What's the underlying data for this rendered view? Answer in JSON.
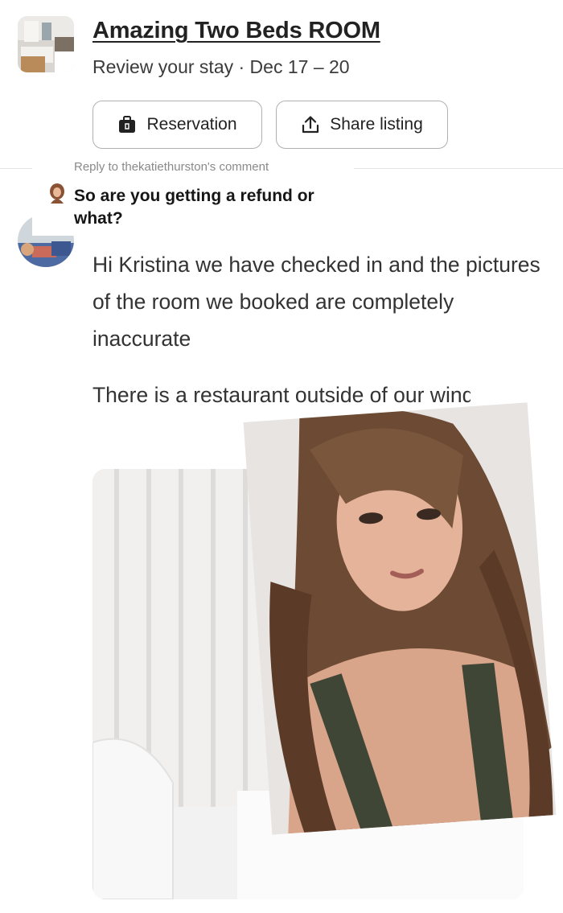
{
  "listing": {
    "title": "Amazing Two Beds ROOM",
    "subtitle": "Review your stay · Dec 17 – 20",
    "thumbnail_icon": "room-thumbnail"
  },
  "actions": {
    "reservation_label": "Reservation",
    "reservation_icon": "briefcase-icon",
    "share_label": "Share listing",
    "share_icon": "share-icon"
  },
  "reply": {
    "meta": "Reply to thekatiethurston's comment",
    "text": "So are you getting a refund or what?"
  },
  "message": {
    "paragraph_1": "Hi Kristina we have checked in and the pictures of the room we booked are completely inaccurate",
    "paragraph_2_visible": "There is a restaurant outside of our window not a view of ou"
  },
  "colors": {
    "text": "#222222",
    "border": "#b0b0b0",
    "muted": "#8a8a8a"
  }
}
